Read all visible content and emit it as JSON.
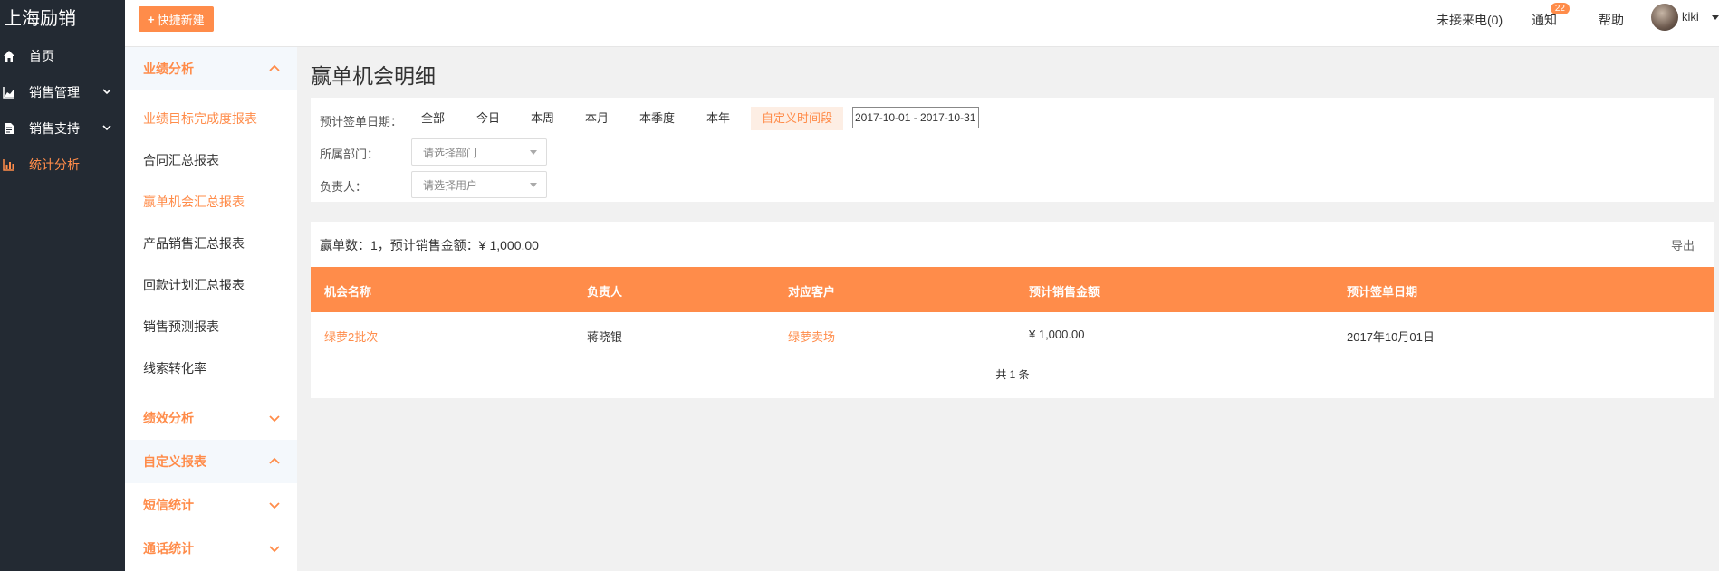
{
  "brand": "上海励销",
  "nav": {
    "items": [
      {
        "label": "首页"
      },
      {
        "label": "销售管理"
      },
      {
        "label": "销售支持"
      },
      {
        "label": "统计分析"
      }
    ]
  },
  "submenu": {
    "section_yeji": "业绩分析",
    "items": [
      "业绩目标完成度报表",
      "合同汇总报表",
      "赢单机会汇总报表",
      "产品销售汇总报表",
      "回款计划汇总报表",
      "销售预测报表",
      "线索转化率"
    ],
    "section_jixiao": "绩效分析",
    "section_custom": "自定义报表",
    "section_sms": "短信统计",
    "section_call": "通话统计"
  },
  "header": {
    "quick_new": "快捷新建",
    "missed_calls": "未接来电(0)",
    "notify": "通知",
    "notify_count": "22",
    "help": "帮助",
    "user": "kiki"
  },
  "page": {
    "title": "赢单机会明细"
  },
  "filters": {
    "date_label": "预计签单日期：",
    "date_options": [
      "全部",
      "今日",
      "本周",
      "本月",
      "本季度",
      "本年",
      "自定义时间段"
    ],
    "date_range": "2017-10-01 - 2017-10-31",
    "dept_label": "所属部门：",
    "dept_placeholder": "请选择部门",
    "owner_label": "负责人：",
    "owner_placeholder": "请选择用户"
  },
  "result": {
    "summary": "赢单数：1，预计销售金额：¥ 1,000.00",
    "export": "导出",
    "columns": [
      "机会名称",
      "负责人",
      "对应客户",
      "预计销售金额",
      "预计签单日期"
    ],
    "rows": [
      [
        "绿萝2批次",
        "蒋晓银",
        "绿萝卖场",
        "¥ 1,000.00",
        "2017年10月01日"
      ]
    ],
    "total": "共 1 条"
  },
  "colors": {
    "accent": "#ff8c4a",
    "nav_bg": "#232a33"
  }
}
